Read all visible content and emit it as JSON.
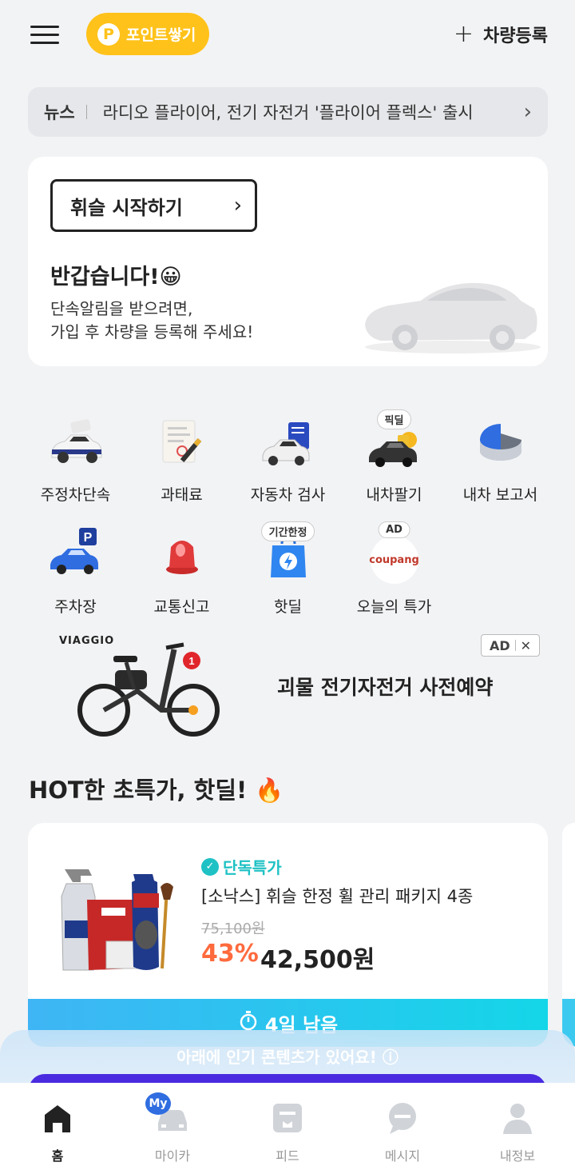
{
  "header": {
    "point_label": "포인트쌓기",
    "point_icon_letter": "P",
    "register_label": "차량등록"
  },
  "news": {
    "tag": "뉴스",
    "headline": "라디오 플라이어, 전기 자전거 '플라이어 플렉스' 출시"
  },
  "welcome": {
    "start_label": "휘슬 시작하기",
    "greeting": "반갑습니다!😀",
    "desc_line1": "단속알림을 받으려면,",
    "desc_line2": "가입 후 차량을 등록해 주세요!"
  },
  "menu": {
    "items": [
      {
        "label": "주정차단속",
        "icon": "enforcement-car-icon"
      },
      {
        "label": "과태료",
        "icon": "fine-document-icon"
      },
      {
        "label": "자동차 검사",
        "icon": "car-inspection-icon"
      },
      {
        "label": "내차팔기",
        "icon": "sell-car-icon",
        "badge": "픽딜"
      },
      {
        "label": "내차 보고서",
        "icon": "car-report-icon"
      },
      {
        "label": "주차장",
        "icon": "parking-icon"
      },
      {
        "label": "교통신고",
        "icon": "traffic-report-siren-icon"
      },
      {
        "label": "핫딜",
        "icon": "hotdeal-bag-icon",
        "badge": "기간한정"
      },
      {
        "label": "오늘의 특가",
        "icon": "coupang-icon",
        "badge": "AD",
        "logo_text": "coupang"
      }
    ]
  },
  "ad_banner": {
    "brand": "VIAGGIO",
    "text": "괴물 전기자전거 사전예약",
    "ad_label": "AD",
    "close": "✕",
    "bike_badge": "1"
  },
  "hotdeal": {
    "title": "HOT한 초특가, 핫딜! 🔥",
    "card": {
      "exclusive_label": "단독특가",
      "product_name": "[소낙스] 휘슬 한정 휠 관리 패키지 4종",
      "original_price": "75,100원",
      "discount": "43%",
      "price": "42,500원",
      "timer": "4일 남음"
    }
  },
  "popular_hint": "아래에 인기 콘텐츠가 있어요!",
  "bottom_nav": {
    "items": [
      {
        "label": "홈",
        "icon": "home-icon",
        "active": true
      },
      {
        "label": "마이카",
        "icon": "mycar-icon",
        "badge": "My"
      },
      {
        "label": "피드",
        "icon": "feed-icon"
      },
      {
        "label": "메시지",
        "icon": "message-icon"
      },
      {
        "label": "내정보",
        "icon": "profile-icon"
      }
    ]
  },
  "colors": {
    "accent_yellow": "#ffc21a",
    "teal": "#1ec1c4",
    "discount_orange": "#ff6a3d",
    "timer_gradient_start": "#3fb5f5",
    "timer_gradient_end": "#14d6e8",
    "nav_blue": "#2f6de0"
  }
}
